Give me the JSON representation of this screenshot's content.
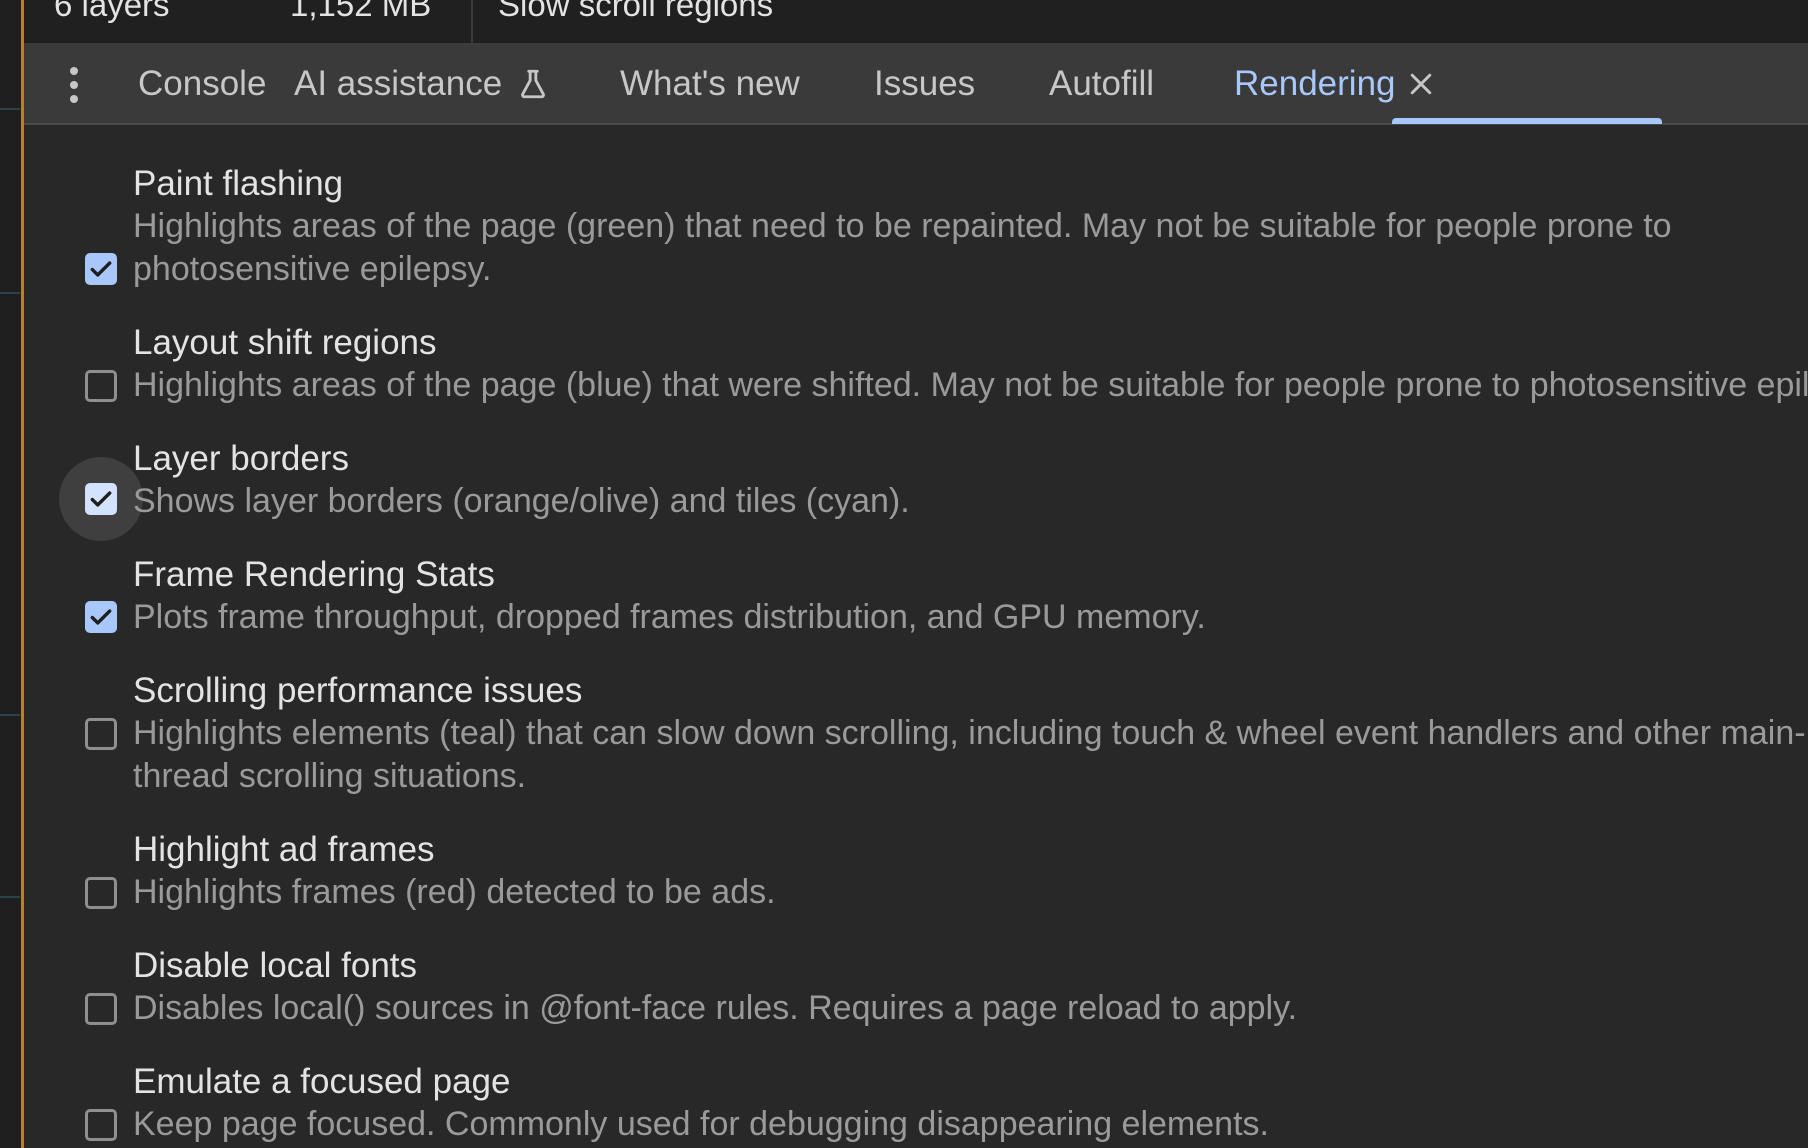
{
  "layer_strip": {
    "layers": "6 layers",
    "memory": "1,152 MB",
    "slow_scroll": "Slow scroll regions"
  },
  "tabs": [
    {
      "label": "Console",
      "active": false
    },
    {
      "label": "AI assistance",
      "active": false,
      "icon": "flask-icon"
    },
    {
      "label": "What's new",
      "active": false
    },
    {
      "label": "Issues",
      "active": false
    },
    {
      "label": "Autofill",
      "active": false
    },
    {
      "label": "Rendering",
      "active": true,
      "icon": "close-icon"
    }
  ],
  "options": [
    {
      "title": "Paint flashing",
      "description": "Highlights areas of the page (green) that need to be repainted. May not be suitable for people prone to photosensitive epilepsy.",
      "checked": true
    },
    {
      "title": "Layout shift regions",
      "description": "Highlights areas of the page (blue) that were shifted. May not be suitable for people prone to photosensitive epilepsy.",
      "checked": false
    },
    {
      "title": "Layer borders",
      "description": "Shows layer borders (orange/olive) and tiles (cyan).",
      "checked": true,
      "hovered": true
    },
    {
      "title": "Frame Rendering Stats",
      "description": "Plots frame throughput, dropped frames distribution, and GPU memory.",
      "checked": true
    },
    {
      "title": "Scrolling performance issues",
      "description": "Highlights elements (teal) that can slow down scrolling, including touch & wheel event handlers and other main-thread scrolling situations.",
      "checked": false
    },
    {
      "title": "Highlight ad frames",
      "description": "Highlights frames (red) detected to be ads.",
      "checked": false
    },
    {
      "title": "Disable local fonts",
      "description": "Disables local() sources in @font-face rules. Requires a page reload to apply.",
      "checked": false
    },
    {
      "title": "Emulate a focused page",
      "description": "Keep page focused. Commonly used for debugging disappearing elements.",
      "checked": false
    }
  ],
  "colors": {
    "background": "#282828",
    "tabbar": "#3a3a3a",
    "accent": "#a8c7fa",
    "text_primary": "#e3e3e3",
    "text_secondary": "#9a9a9a"
  }
}
